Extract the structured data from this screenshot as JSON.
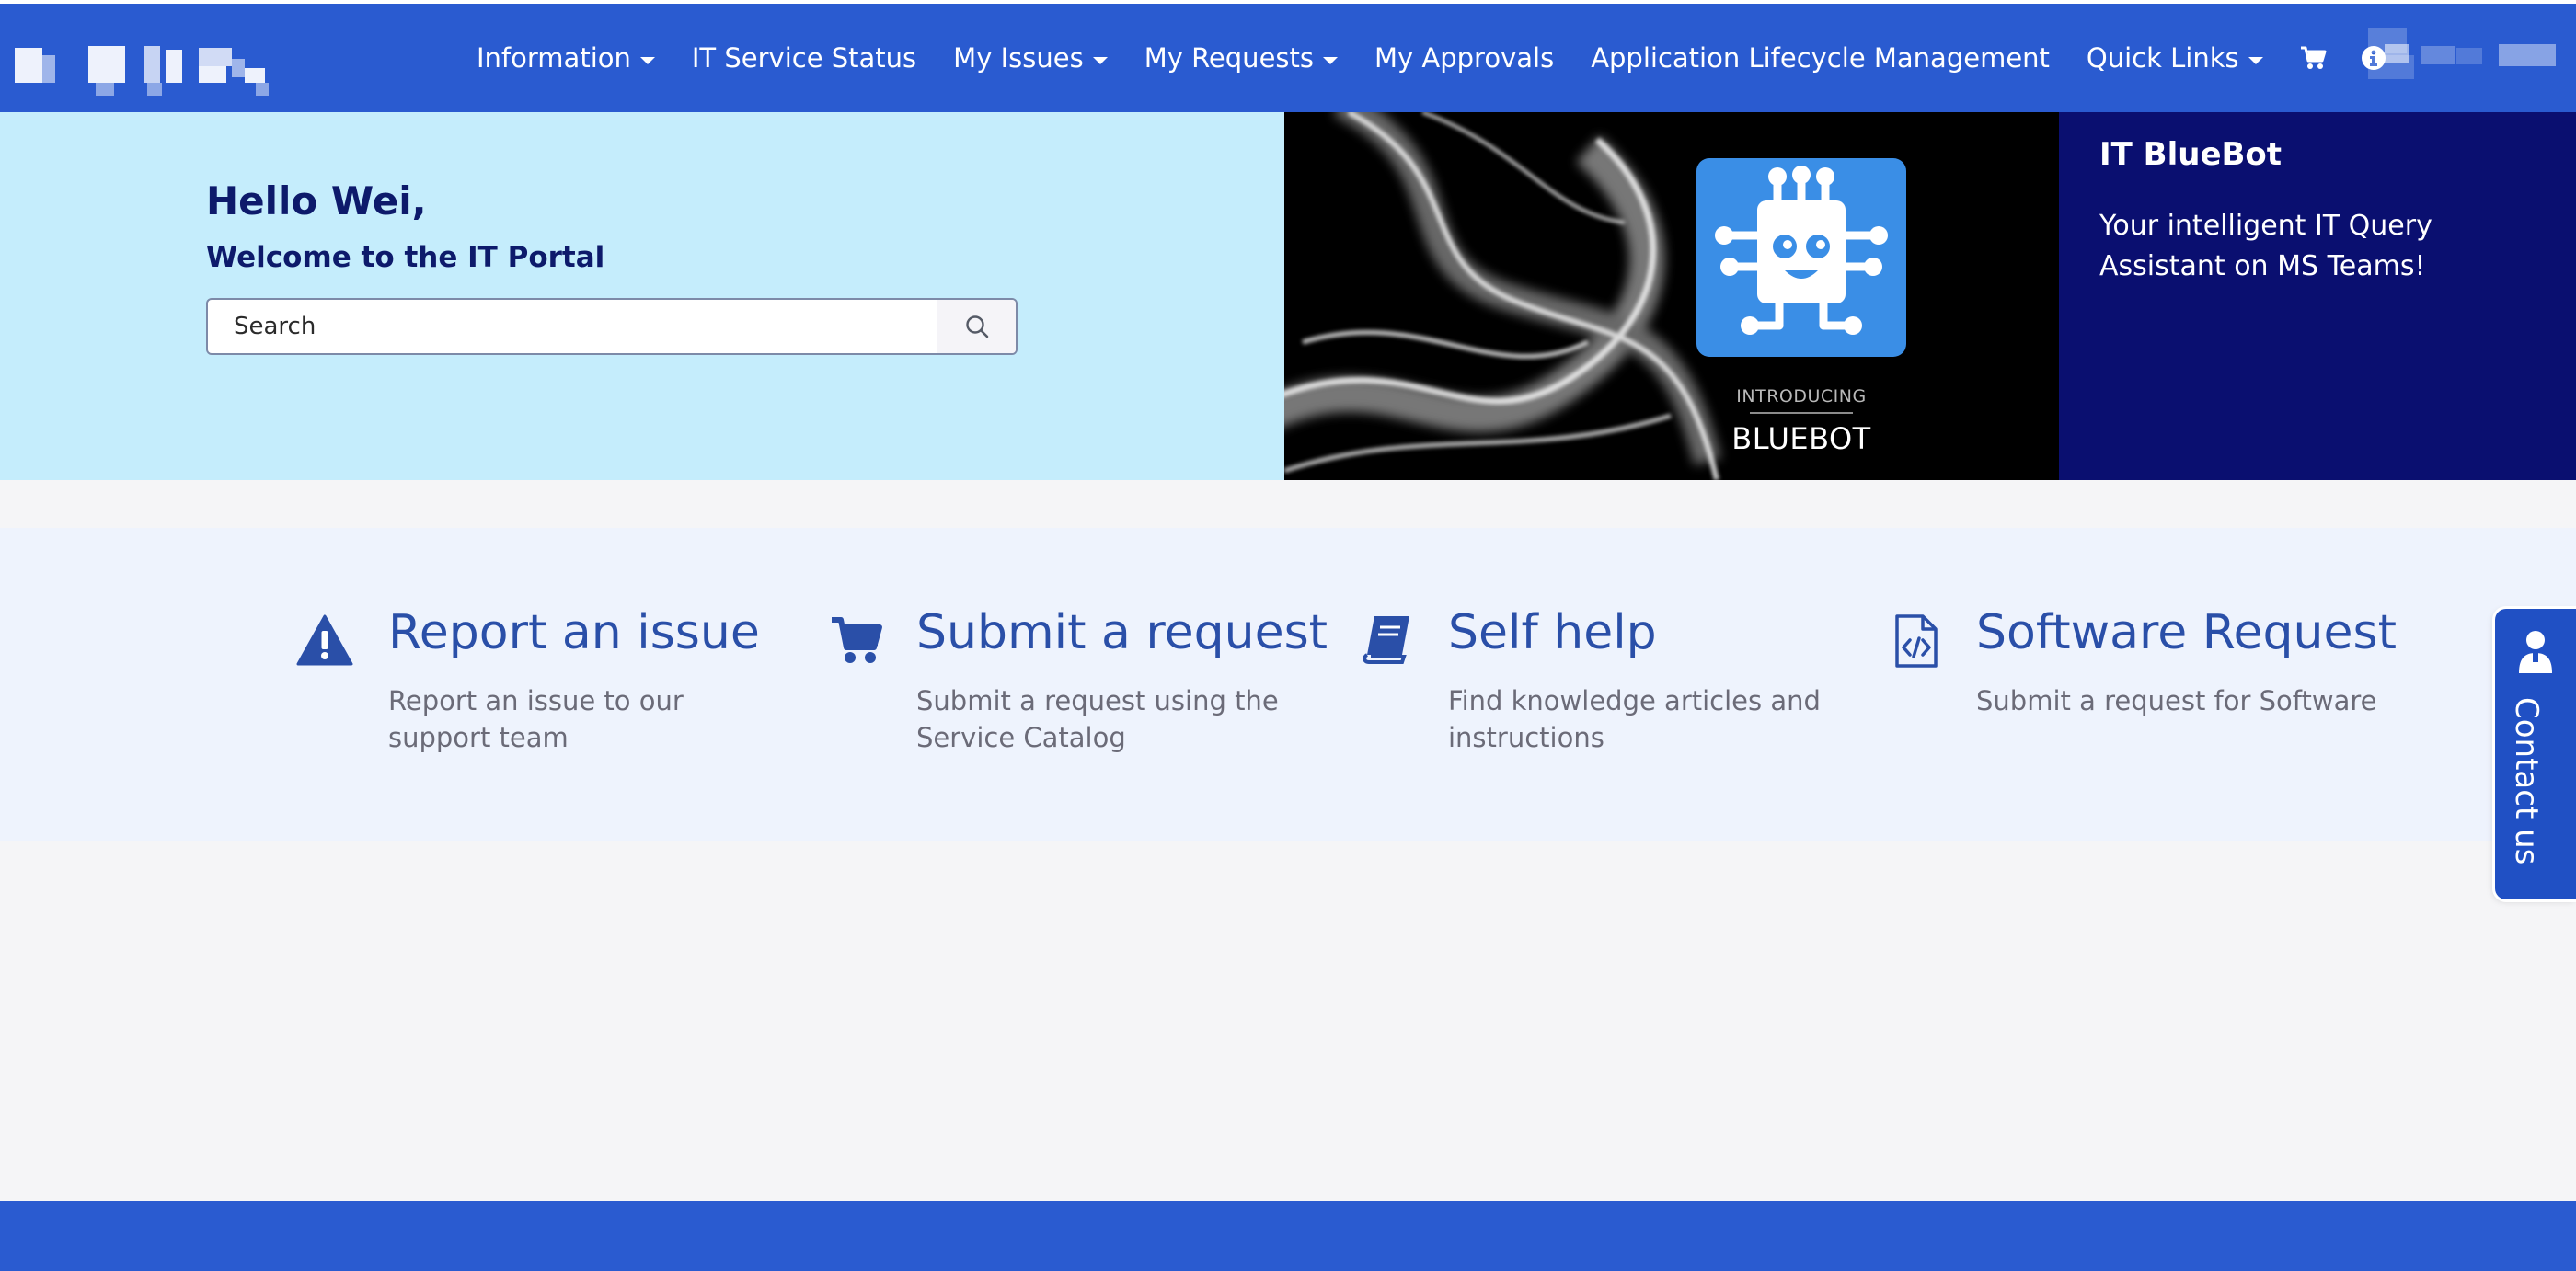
{
  "nav": {
    "items": [
      {
        "label": "Information",
        "dropdown": true
      },
      {
        "label": "IT Service Status",
        "dropdown": false
      },
      {
        "label": "My Issues",
        "dropdown": true
      },
      {
        "label": "My Requests",
        "dropdown": true
      },
      {
        "label": "My Approvals",
        "dropdown": false
      },
      {
        "label": "Application Lifecycle Management",
        "dropdown": false
      },
      {
        "label": "Quick Links",
        "dropdown": true
      }
    ],
    "icons": [
      "cart-icon",
      "info-icon"
    ]
  },
  "hero": {
    "greeting": "Hello Wei,",
    "welcome": "Welcome to the IT Portal",
    "search_placeholder": "Search"
  },
  "promo": {
    "image_introducing": "INTRODUCING",
    "image_title": "BLUEBOT",
    "title": "IT BlueBot",
    "text": "Your intelligent IT Query Assistant on MS Teams!"
  },
  "actions": [
    {
      "icon": "warning-icon",
      "title": "Report an issue",
      "description": "Report an issue to our support team"
    },
    {
      "icon": "cart-icon",
      "title": "Submit a request",
      "description": "Submit a request using the Service Catalog"
    },
    {
      "icon": "book-icon",
      "title": "Self help",
      "description": "Find knowledge articles and instructions"
    },
    {
      "icon": "code-file-icon",
      "title": "Software Request",
      "description": "Submit a request for Software"
    }
  ],
  "contact": {
    "label": "Contact us"
  },
  "colors": {
    "nav_bg": "#2a5bd0",
    "hero_left_bg": "#c5edfc",
    "promo_bg": "#0a0f70",
    "action_blue": "#2a4fa8",
    "contact_bg": "#2050c4"
  }
}
